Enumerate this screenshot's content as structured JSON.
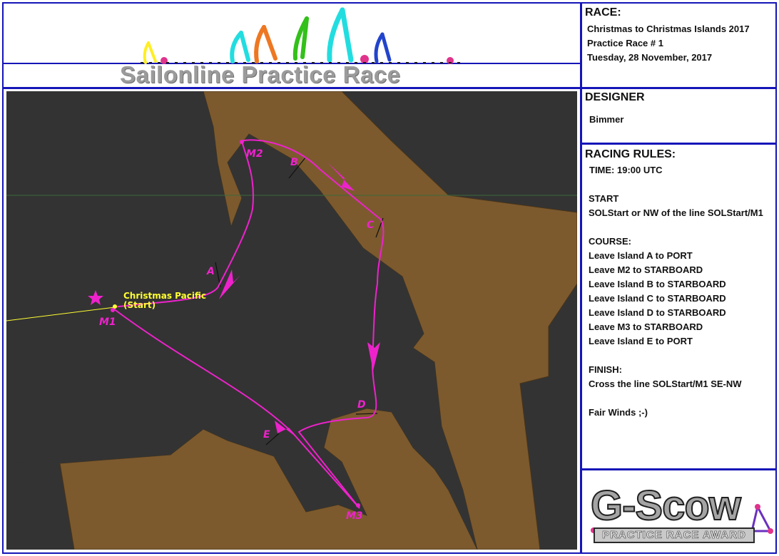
{
  "banner": {
    "title": "Sailonline Practice Race"
  },
  "race": {
    "heading": "RACE:",
    "lines": [
      "Christmas to Christmas Islands 2017",
      "Practice Race # 1",
      "Tuesday, 28 November, 2017"
    ]
  },
  "designer": {
    "heading": "DESIGNER",
    "name": "Bimmer"
  },
  "rules": {
    "heading": "RACING RULES:",
    "time": "TIME: 19:00 UTC",
    "start_heading": "START",
    "start_text": "SOLStart or NW of the line SOLStart/M1",
    "course_heading": "COURSE:",
    "course": [
      "Leave Island A to PORT",
      "Leave M2 to STARBOARD",
      "Leave Island B to STARBOARD",
      "Leave Island C to STARBOARD",
      "Leave Island D to STARBOARD",
      "Leave M3 to STARBOARD",
      "Leave Island E to PORT"
    ],
    "finish_heading": "FINISH:",
    "finish_text": "Cross the line SOLStart/M1 SE-NW",
    "closing": "Fair Winds ;-)"
  },
  "map": {
    "start_label_1": "Christmas Pacific",
    "start_label_2": "(Start)",
    "marks": {
      "m1": "M1",
      "m2": "M2",
      "m3": "M3",
      "a": "A",
      "b": "B",
      "c": "C",
      "d": "D",
      "e": "E"
    },
    "colors": {
      "water": "#333333",
      "land": "#7c5a2e",
      "route": "#ee22cc",
      "start": "#ffff33"
    }
  },
  "award": {
    "title": "G-Scow",
    "subtitle": "PRACTICE RACE AWARD"
  }
}
